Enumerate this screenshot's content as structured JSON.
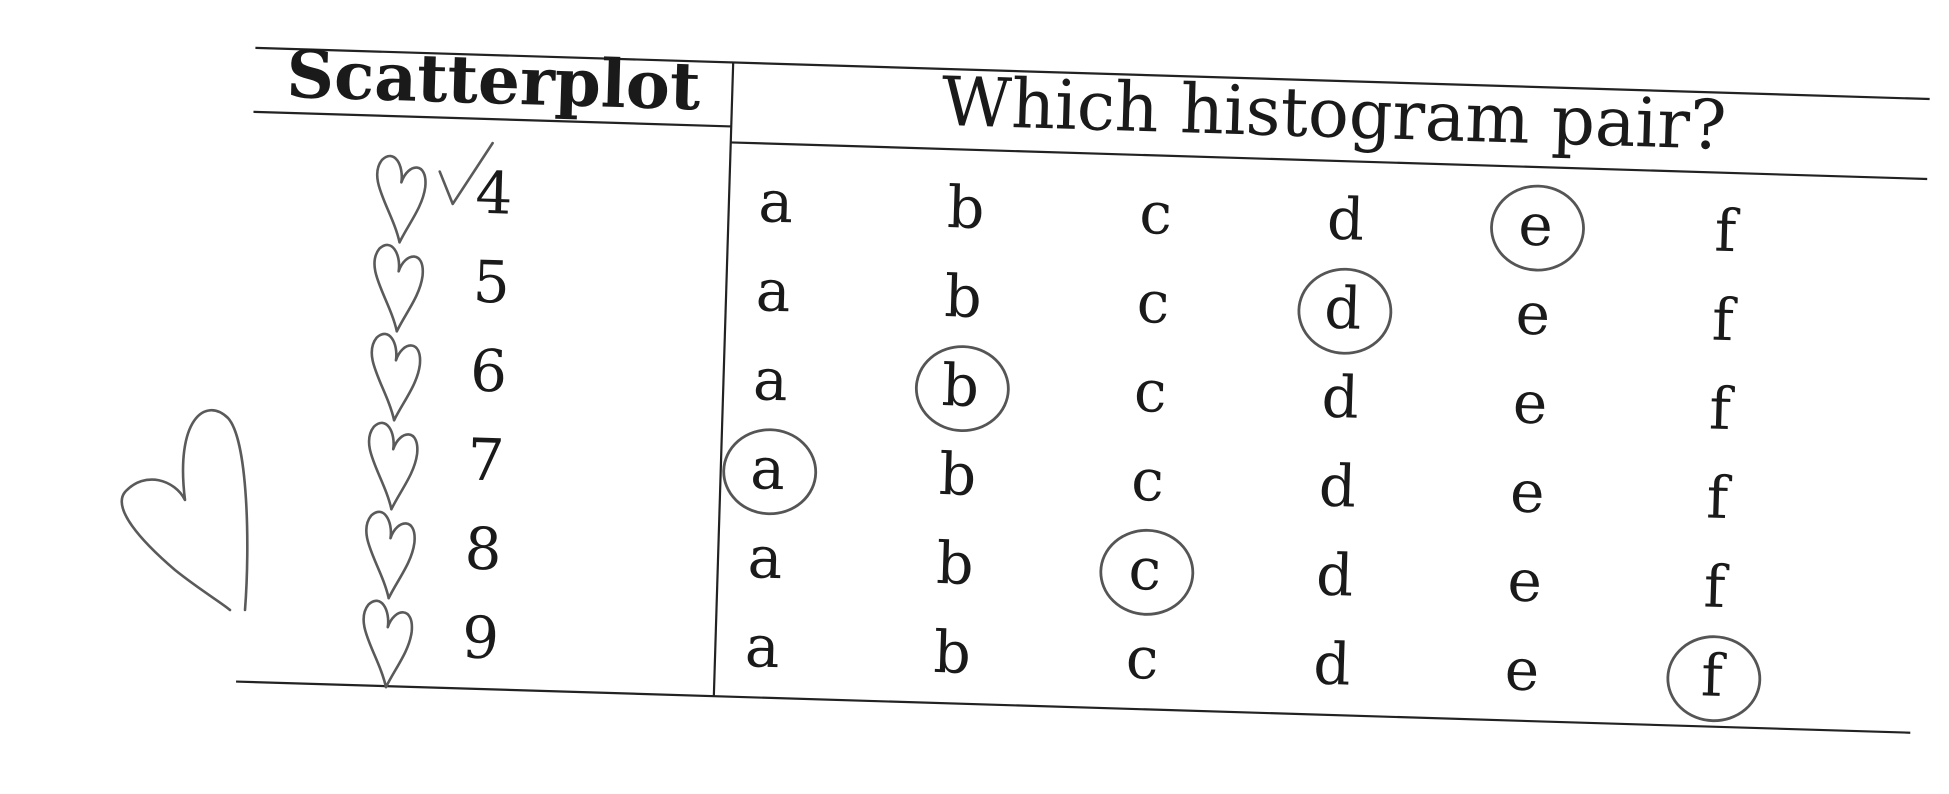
{
  "table": {
    "header_left": "Scatterplot",
    "header_right": "Which histogram pair?",
    "options": [
      "a",
      "b",
      "c",
      "d",
      "e",
      "f"
    ],
    "rows": [
      {
        "scatterplot": "4",
        "circled": "e",
        "checkmark": true
      },
      {
        "scatterplot": "5",
        "circled": "d",
        "checkmark": false
      },
      {
        "scatterplot": "6",
        "circled": "b",
        "checkmark": false
      },
      {
        "scatterplot": "7",
        "circled": "a",
        "checkmark": false
      },
      {
        "scatterplot": "8",
        "circled": "c",
        "checkmark": false
      },
      {
        "scatterplot": "9",
        "circled": "f",
        "checkmark": false
      }
    ]
  },
  "annotations": {
    "hearts_next_to_rows": 6,
    "large_heart_in_margin": 1,
    "ink_color": "#555555"
  }
}
